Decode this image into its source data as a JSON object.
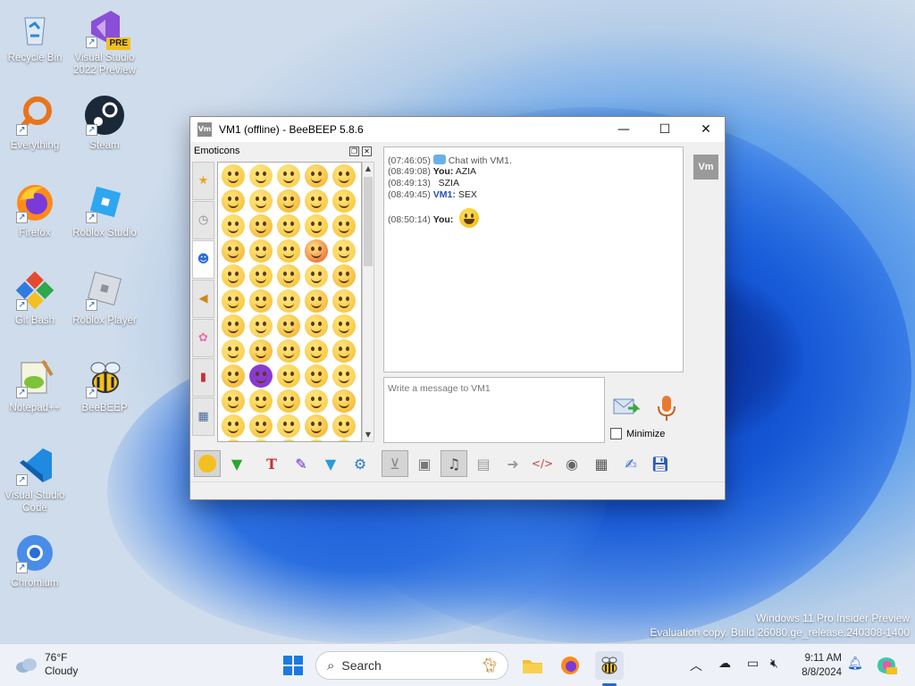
{
  "desktop": {
    "icons": [
      {
        "label": "Recycle Bin"
      },
      {
        "label": "Visual Studio 2022 Preview",
        "badge": "PRE"
      },
      {
        "label": "Everything"
      },
      {
        "label": "Steam"
      },
      {
        "label": "Firefox"
      },
      {
        "label": "Roblox Studio"
      },
      {
        "label": "Git Bash"
      },
      {
        "label": "Roblox Player"
      },
      {
        "label": "Notepad++"
      },
      {
        "label": "BeeBEEP"
      },
      {
        "label": "Visual Studio Code"
      },
      {
        "label": "Chromium"
      }
    ],
    "watermark": {
      "line1": "Windows 11 Pro Insider Preview",
      "line2": "Evaluation copy. Build 26080.ge_release.240308-1400"
    }
  },
  "window": {
    "app_icon": "Vm",
    "title": "VM1 (offline) - BeeBEEP 5.8.6",
    "controls": {
      "minimize": "—",
      "maximize": "☐",
      "close": "✕"
    },
    "emoticons_panel": {
      "title": "Emoticons",
      "tabs": [
        "star-icon",
        "clock-icon",
        "people-icon",
        "horn-icon",
        "flower-icon",
        "car-icon",
        "keypad-icon"
      ],
      "active_tab": 2
    },
    "chat": {
      "lines": [
        {
          "time": "(07:46:05)",
          "sender": "",
          "text": "Chat with VM1."
        },
        {
          "time": "(08:49:08)",
          "sender": "You:",
          "text": "AZIA"
        },
        {
          "time": "(08:49:13)",
          "sender": "",
          "text": "SZIA"
        },
        {
          "time": "(08:49:45)",
          "sender": "VM1:",
          "text": "SEX"
        },
        {
          "time": "(08:50:14)",
          "sender": "You:",
          "text": ""
        }
      ]
    },
    "user_badge": "Vm",
    "input": {
      "placeholder": "Write a message to VM1"
    },
    "minimize_label": "Minimize",
    "toolbar": [
      "emoticon-icon",
      "dropdown-icon",
      "font-icon",
      "color-icon",
      "filter-icon",
      "settings-icon",
      "inbox-icon",
      "book-icon",
      "music-icon",
      "file-icon",
      "share-icon",
      "code-icon",
      "record-icon",
      "window-icon",
      "note-icon",
      "save-icon"
    ]
  },
  "taskbar": {
    "weather": {
      "temp": "76°F",
      "condition": "Cloudy"
    },
    "search_placeholder": "Search",
    "clock": {
      "time": "9:11 AM",
      "date": "8/8/2024"
    }
  }
}
